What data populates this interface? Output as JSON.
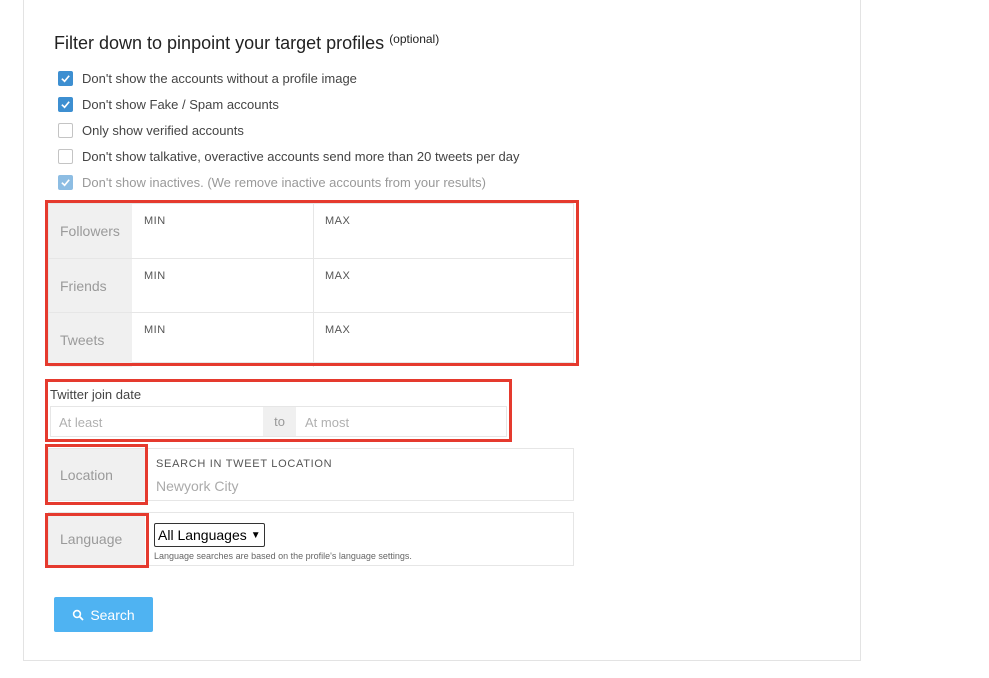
{
  "filter": {
    "title": "Filter down to pinpoint your target profiles",
    "optional": "(optional)",
    "checkboxes": [
      {
        "label": "Don't show the accounts without a profile image",
        "checked": true
      },
      {
        "label": "Don't show Fake / Spam accounts",
        "checked": true
      },
      {
        "label": "Only show verified accounts",
        "checked": false
      },
      {
        "label": "Don't show talkative, overactive accounts send more than 20 tweets per day",
        "checked": false
      },
      {
        "label": "Don't show inactives. (We remove inactive accounts from your results)",
        "checked": true,
        "disabled": true
      }
    ]
  },
  "ranges": {
    "min_label": "MIN",
    "max_label": "MAX",
    "rows": [
      {
        "label": "Followers"
      },
      {
        "label": "Friends"
      },
      {
        "label": "Tweets"
      }
    ]
  },
  "join_date": {
    "label": "Twitter join date",
    "start_placeholder": "At least",
    "to": "to",
    "end_placeholder": "At most"
  },
  "location": {
    "label": "Location",
    "caption": "SEARCH IN TWEET LOCATION",
    "placeholder": "Newyork City"
  },
  "language": {
    "label": "Language",
    "selected": "All Languages",
    "note": "Language searches are based on the profile's language settings."
  },
  "search_button": {
    "label": "Search",
    "icon": "search-icon"
  },
  "colors": {
    "accent": "#3d8fd1",
    "button": "#4fb3f2",
    "highlight": "#e53a2e"
  }
}
